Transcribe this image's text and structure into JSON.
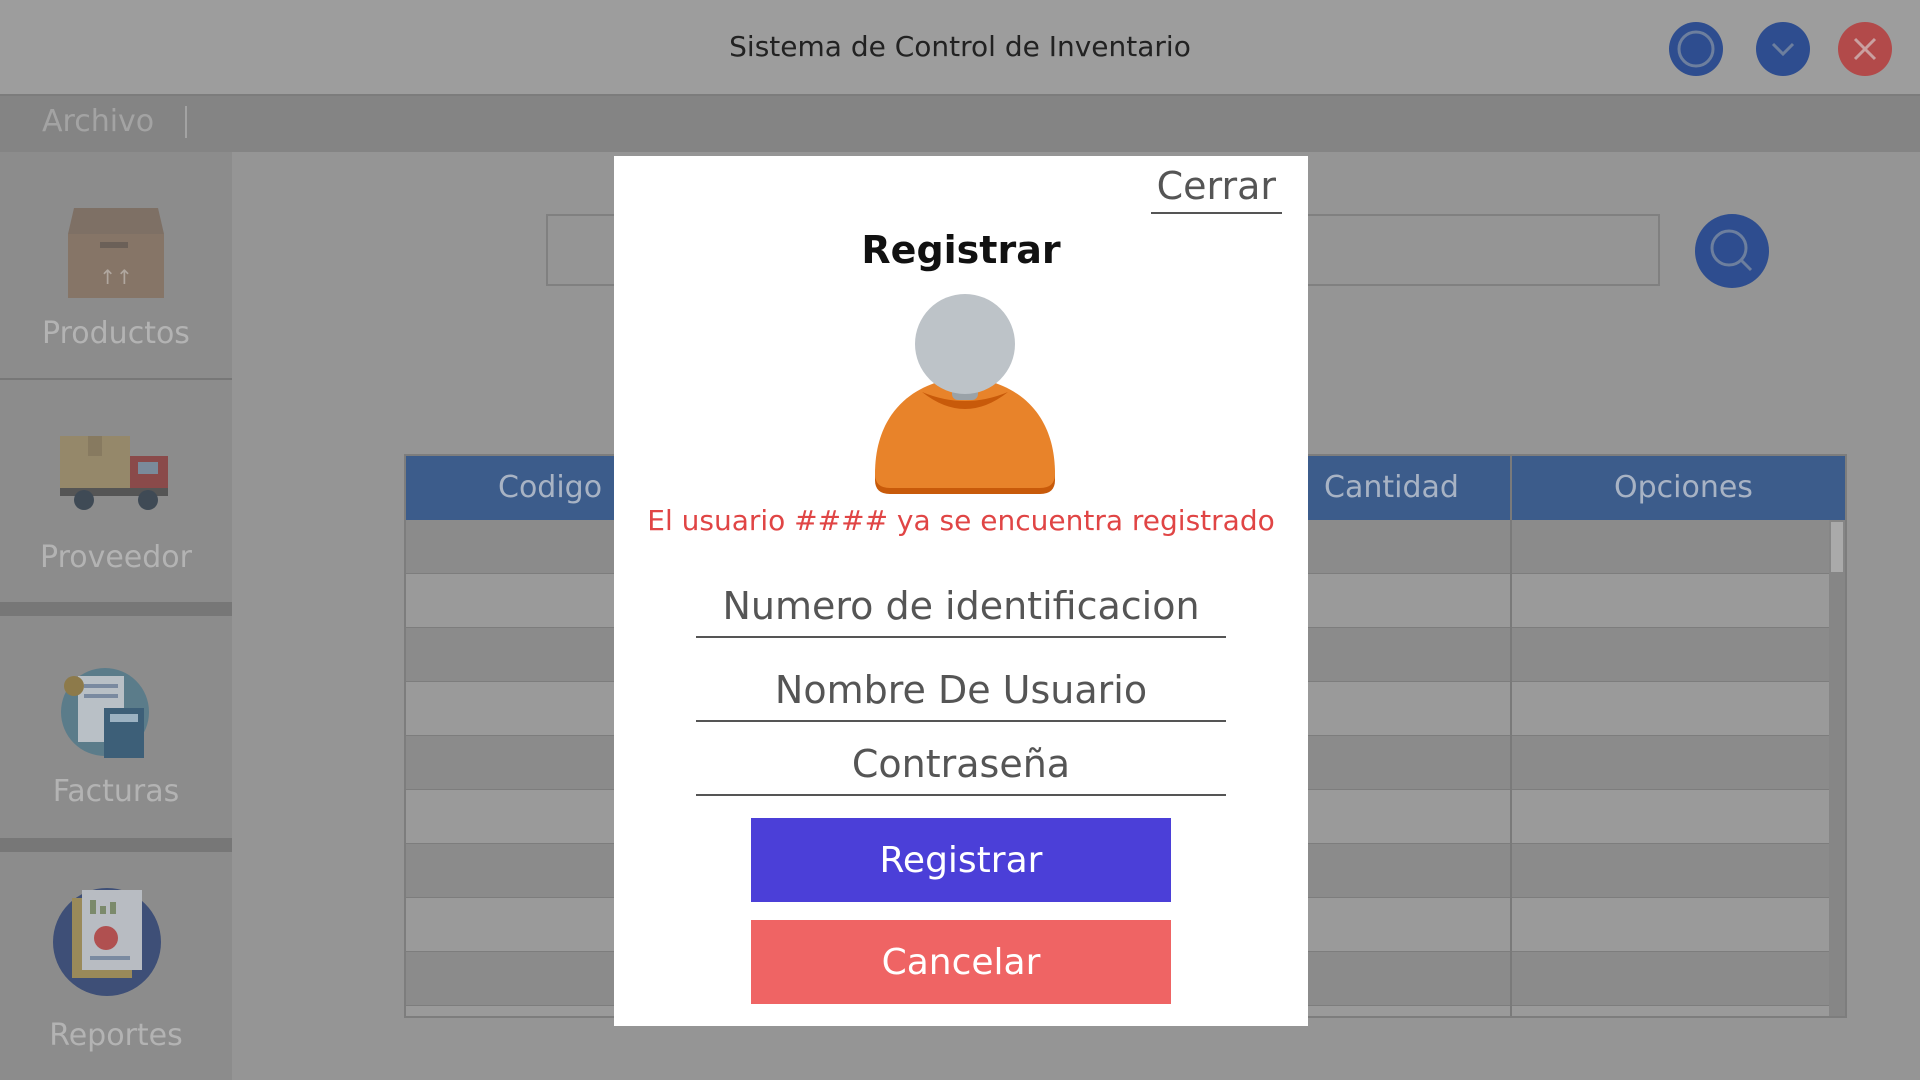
{
  "window": {
    "title": "Sistema de Control de Inventario",
    "buttons": [
      "restore-icon",
      "minimize-icon",
      "close-icon"
    ]
  },
  "menu": {
    "items": [
      {
        "label": "Archivo"
      }
    ]
  },
  "sidebar": {
    "items": [
      {
        "label": "Productos",
        "icon": "box-icon"
      },
      {
        "label": "Proveedor",
        "icon": "truck-icon"
      },
      {
        "label": "Facturas",
        "icon": "invoice-icon"
      },
      {
        "label": "Reportes",
        "icon": "reports-icon"
      }
    ]
  },
  "table": {
    "columns": [
      "Codigo",
      "Cantidad",
      "Opciones"
    ]
  },
  "modal": {
    "close_label": "Cerrar",
    "title": "Registrar",
    "error_message": "El usuario #### ya se encuentra registrado",
    "fields": {
      "id_placeholder": "Numero de identificacion",
      "username_placeholder": "Nombre De Usuario",
      "password_placeholder": "Contraseña"
    },
    "submit_label": "Registrar",
    "cancel_label": "Cancelar"
  },
  "colors": {
    "overlay_bg": "#959595",
    "accent_blue": "#2e4d8f",
    "submit": "#4b3fd8",
    "cancel": "#ef6464",
    "error": "#e04545"
  }
}
